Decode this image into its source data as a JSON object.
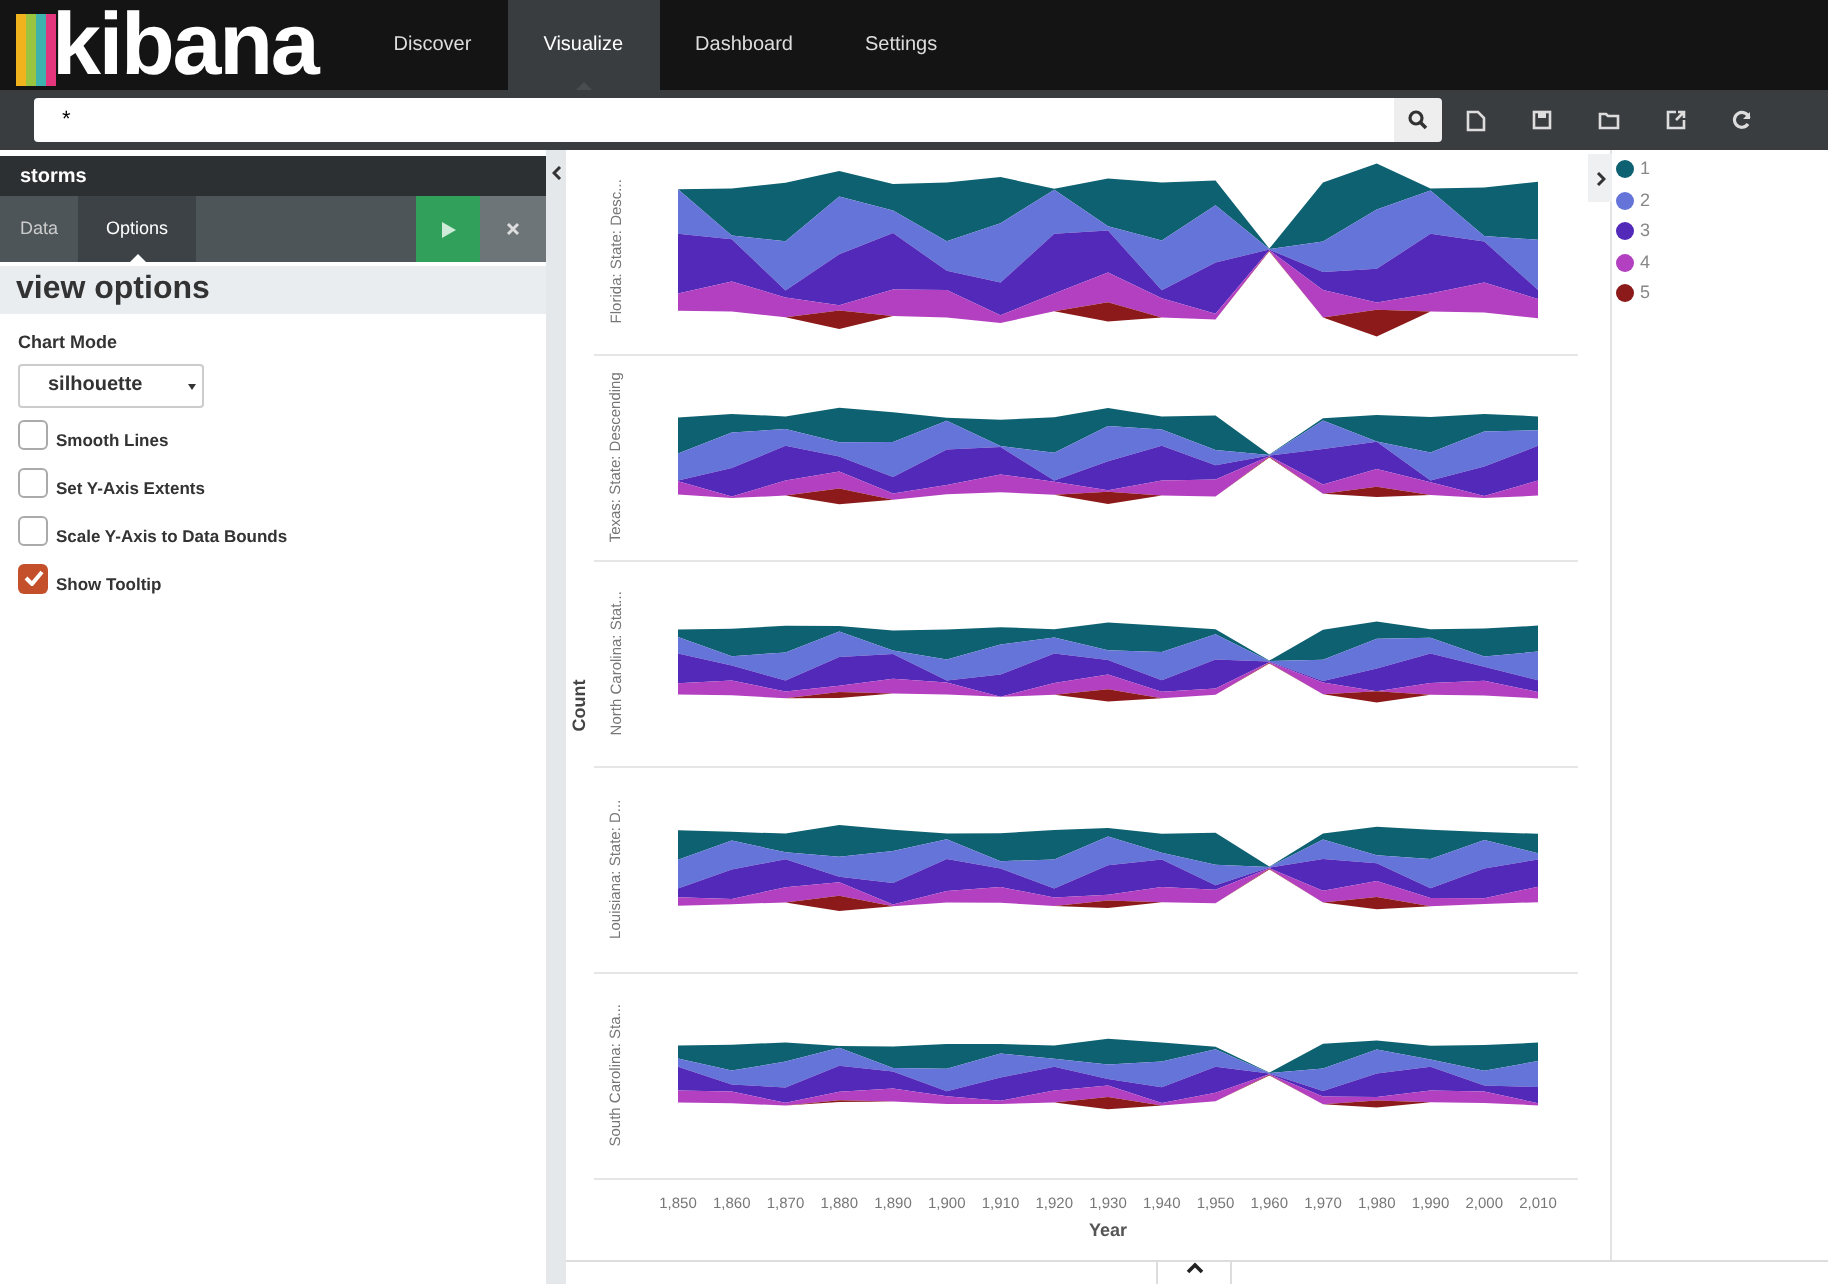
{
  "nav": {
    "logo": "kibana",
    "tabs": [
      {
        "label": "Discover",
        "selected": false
      },
      {
        "label": "Visualize",
        "selected": true
      },
      {
        "label": "Dashboard",
        "selected": false
      },
      {
        "label": "Settings",
        "selected": false
      }
    ]
  },
  "search": {
    "value": "*"
  },
  "panel": {
    "title": "storms",
    "tabs": [
      {
        "label": "Data",
        "selected": false
      },
      {
        "label": "Options",
        "selected": true
      }
    ],
    "heading": "view options",
    "chart_mode": {
      "label": "Chart Mode",
      "value": "silhouette"
    },
    "options": [
      {
        "label": "Smooth Lines",
        "checked": false
      },
      {
        "label": "Set Y-Axis Extents",
        "checked": false
      },
      {
        "label": "Scale Y-Axis to Data Bounds",
        "checked": false
      },
      {
        "label": "Show Tooltip",
        "checked": true
      }
    ]
  },
  "chart": {
    "ylabel": "Count",
    "xlabel": "Year",
    "rows": [
      {
        "label": "Florida: State: Desc..."
      },
      {
        "label": "Texas: State: Descending"
      },
      {
        "label": "North Carolina: Stat..."
      },
      {
        "label": "Louisiana: State: D..."
      },
      {
        "label": "South Carolina: Sta..."
      }
    ],
    "xticks": [
      "1,850",
      "1,860",
      "1,870",
      "1,880",
      "1,890",
      "1,900",
      "1,910",
      "1,920",
      "1,930",
      "1,940",
      "1,950",
      "1,960",
      "1,970",
      "1,980",
      "1,990",
      "2,000",
      "2,010"
    ]
  },
  "legend": [
    {
      "label": "1",
      "color": "#0e6171"
    },
    {
      "label": "2",
      "color": "#6474d8"
    },
    {
      "label": "3",
      "color": "#5229b8"
    },
    {
      "label": "4",
      "color": "#b340c0"
    },
    {
      "label": "5",
      "color": "#8c1a1a"
    }
  ]
}
